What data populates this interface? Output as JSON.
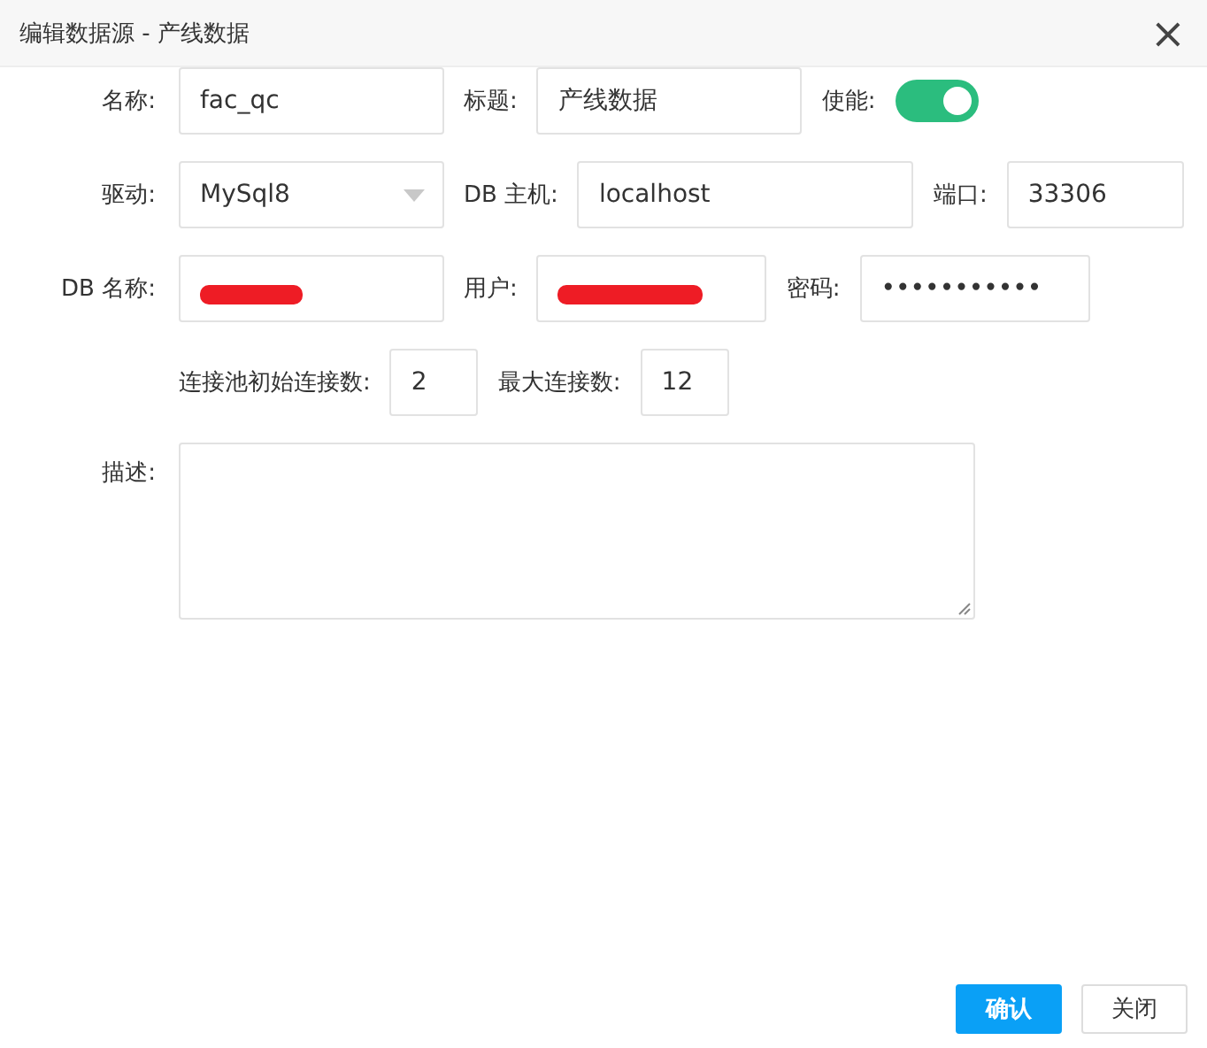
{
  "dialog": {
    "title": "编辑数据源 - 产线数据",
    "close_glyph": "×"
  },
  "rows": [
    {
      "fields": [
        {
          "kind": "text",
          "label": "名称:",
          "value": "fac_qc"
        },
        {
          "kind": "text",
          "label": "标题:",
          "value": "产线数据"
        },
        {
          "kind": "switch",
          "label": "使能:",
          "on": true
        }
      ]
    },
    {
      "fields": [
        {
          "kind": "select",
          "label": "驱动:",
          "value": "MySql8"
        },
        {
          "kind": "text",
          "label": "DB 主机:",
          "value": "localhost"
        },
        {
          "kind": "text",
          "label": "端口:",
          "value": "33306"
        }
      ]
    },
    {
      "fields": [
        {
          "kind": "text",
          "label": "DB 名称:",
          "redacted": true
        },
        {
          "kind": "text",
          "label": "用户:",
          "redacted": true
        },
        {
          "kind": "password",
          "label": "密码:",
          "value": "•••••••••••"
        }
      ]
    },
    {
      "indent": true,
      "fields": [
        {
          "kind": "text",
          "label": "连接池初始连接数:",
          "value": "2"
        },
        {
          "kind": "text",
          "label": "最大连接数:",
          "value": "12"
        }
      ]
    },
    {
      "fields": [
        {
          "kind": "textarea",
          "label": "描述:"
        }
      ]
    }
  ],
  "buttons": [
    {
      "label": "确认",
      "primary": true
    },
    {
      "label": "关闭",
      "primary": false
    }
  ]
}
